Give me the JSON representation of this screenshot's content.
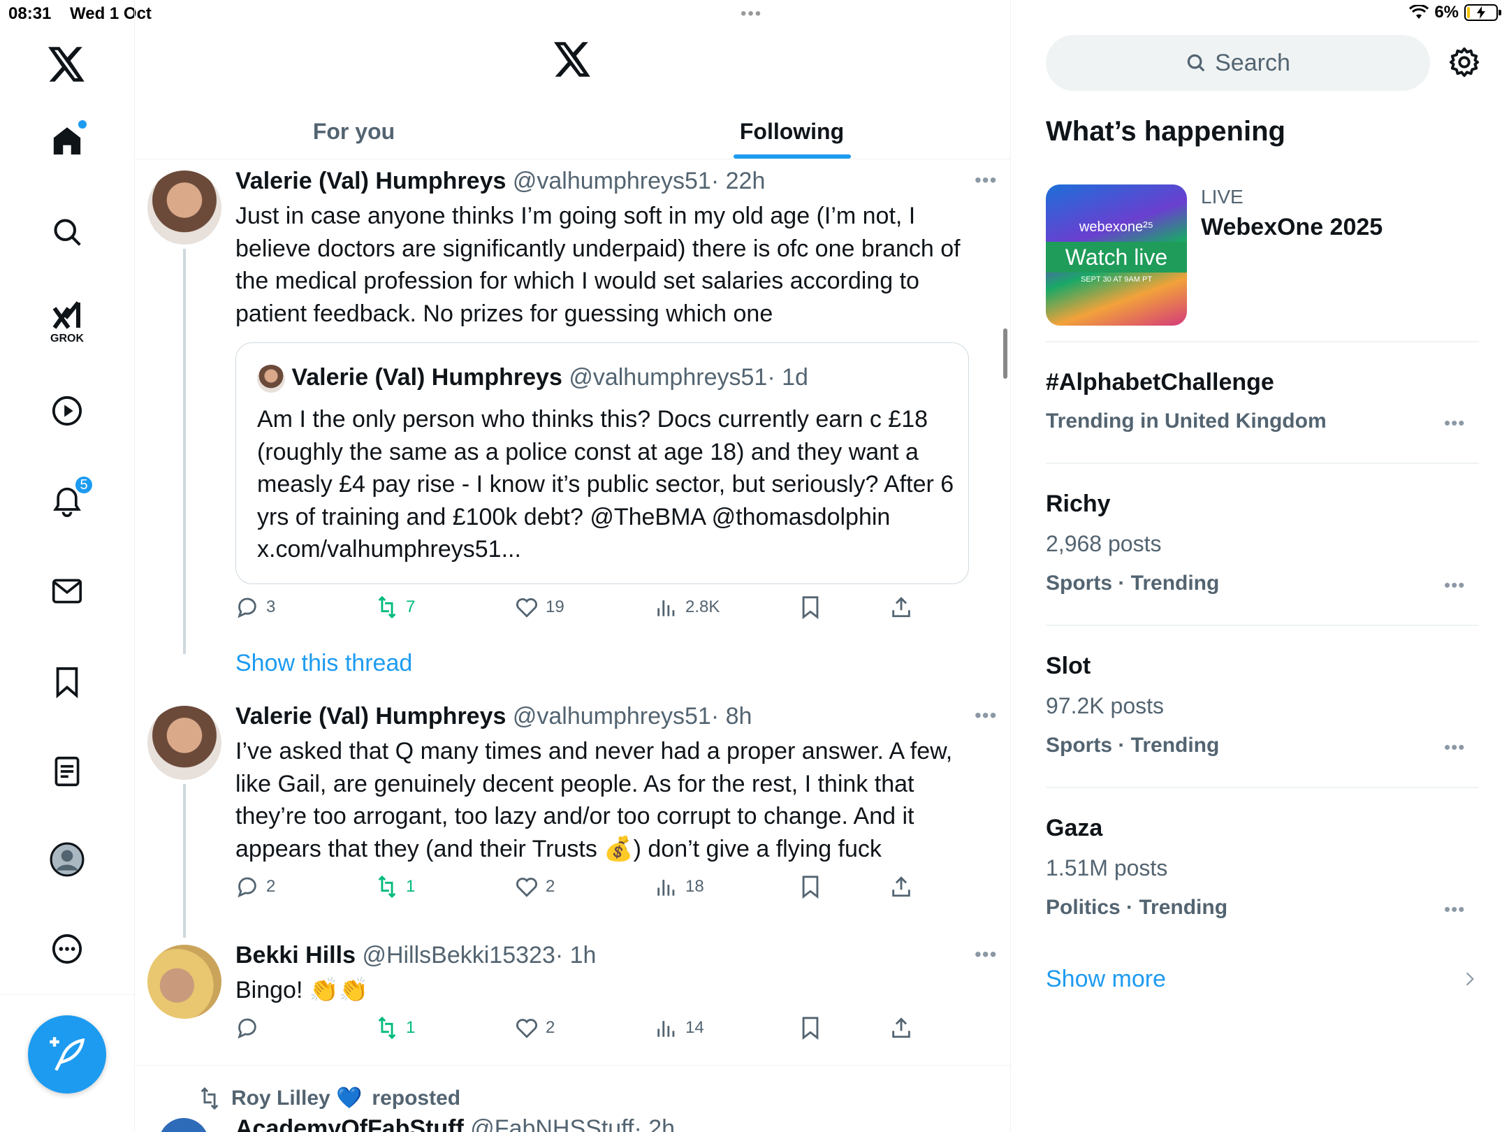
{
  "status": {
    "time": "08:31",
    "date": "Wed 1 Oct",
    "battery": "6%"
  },
  "nav": {
    "notifications_badge": "5",
    "grok_label": "GROK"
  },
  "tabs": [
    {
      "label": "For you",
      "active": false
    },
    {
      "label": "Following",
      "active": true
    }
  ],
  "tweets": [
    {
      "name": "Valerie (Val) Humphreys",
      "handle": "@valhumphreys51",
      "time": "· 22h",
      "text": "Just in case anyone thinks I’m going soft in my old age (I’m not, I believe doctors are significantly underpaid) there is ofc one branch of the medical profession for which I would set salaries according to patient feedback. No prizes for guessing which one",
      "quote": {
        "name": "Valerie (Val) Humphreys",
        "handle": "@valhumphreys51",
        "time": "· 1d",
        "text": "Am I the only person who thinks this? Docs currently earn c £18 (roughly the same as a police const at age 18) and they want a measly £4 pay rise - I know it’s public sector, but seriously? After 6 yrs of training and £100k debt? @TheBMA @thomasdolphin x.com/valhumphreys51..."
      },
      "replies": "3",
      "reposts": "7",
      "likes": "19",
      "views": "2.8K"
    },
    {
      "name": "Valerie (Val) Humphreys",
      "handle": "@valhumphreys51",
      "time": "· 8h",
      "text": "I’ve asked that Q many times and never had a proper answer. A few, like Gail, are genuinely decent people. As for the rest, I think that they’re too arrogant, too lazy and/or too corrupt to change. And it appears that they (and their Trusts 💰) don’t give a flying fuck",
      "replies": "2",
      "reposts": "1",
      "likes": "2",
      "views": "18"
    },
    {
      "name": "Bekki Hills",
      "handle": "@HillsBekki15323",
      "time": "· 1h",
      "text": "Bingo! 👏👏",
      "replies": "",
      "reposts": "1",
      "likes": "2",
      "views": "14"
    }
  ],
  "show_thread": "Show this thread",
  "repost_bar": {
    "user": "Roy Lilley 💙",
    "action": "reposted"
  },
  "next_tweet": {
    "name": "AcademyOfFabStuff",
    "handle": "@FabNHSStuff",
    "time": "· 2h"
  },
  "sidebar": {
    "search_placeholder": "Search",
    "whats_happening": "What’s happening",
    "live": {
      "label": "LIVE",
      "name": "WebexOne 2025",
      "card_brand": "webexone²⁵",
      "card_cta": "Watch live",
      "card_date": "SEPT 30 AT 9AM PT"
    },
    "trends": [
      {
        "title": "#AlphabetChallenge",
        "sub": "Trending in United Kingdom",
        "posts": ""
      },
      {
        "title": "Richy",
        "posts": "2,968 posts",
        "sub": "Sports · Trending"
      },
      {
        "title": "Slot",
        "posts": "97.2K posts",
        "sub": "Sports · Trending"
      },
      {
        "title": "Gaza",
        "posts": "1.51M posts",
        "sub": "Politics · Trending"
      }
    ],
    "show_more": "Show more"
  },
  "colors": {
    "accent": "#1d9bf0",
    "repost_green": "#00ba7c",
    "secondary_text": "#536471"
  }
}
